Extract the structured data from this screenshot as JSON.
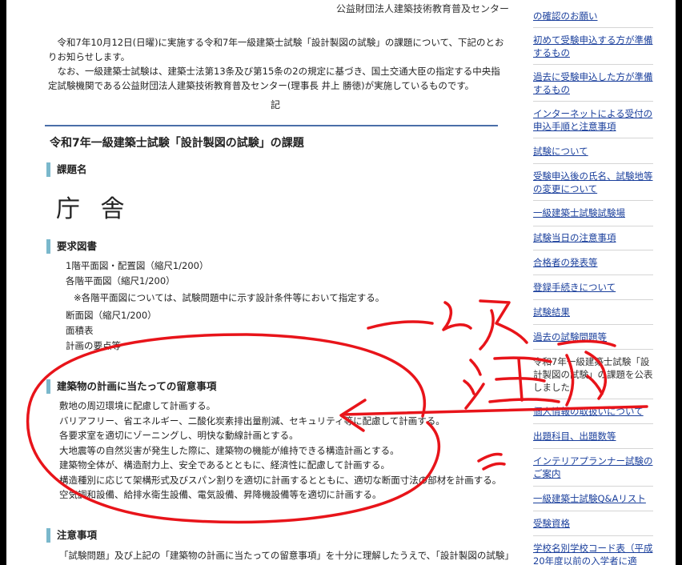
{
  "header": {
    "org": "公益財団法人建築技術教育普及センター"
  },
  "intro": {
    "p1": "令和7年10月12日(日曜)に実施する令和7年一級建築士試験「設計製図の試験」の課題について、下記のとおりお知らせします。",
    "p2": "なお、一級建築士試験は、建築士法第13条及び第15条の2の規定に基づき、国土交通大臣の指定する中央指定試験機関である公益財団法人建築技術教育普及センター(理事長 井上 勝徳)が実施しているものです。",
    "ki": "記"
  },
  "main": {
    "section_title": "令和7年一級建築士試験「設計製図の試験」の課題",
    "h_title": "課題名",
    "title_value": "庁 舎",
    "h_drawings": "要求図書",
    "drawings": [
      "1階平面図・配置図（縮尺1/200）",
      "各階平面図（縮尺1/200）",
      "※各階平面図については、試験問題中に示す設計条件等において指定する。",
      "断面図（縮尺1/200）",
      "面積表",
      "計画の要点等"
    ],
    "h_notes": "建築物の計画に当たっての留意事項",
    "notes": [
      "敷地の周辺環境に配慮して計画する。",
      "バリアフリー、省エネルギー、二酸化炭素排出量削減、セキュリティ等に配慮して計画する。",
      "各要求室を適切にゾーニングし、明快な動線計画とする。",
      "大地震等の自然災害が発生した際に、建築物の機能が維持できる構造計画とする。",
      "建築物全体が、構造耐力上、安全であるとともに、経済性に配慮して計画する。",
      "構造種別に応じて架構形式及びスパン割りを適切に計画するとともに、適切な断面寸法の部材を計画する。",
      "空気調和設備、給排水衛生設備、電気設備、昇降機設備等を適切に計画する。"
    ],
    "h_caution": "注意事項",
    "caution_line": "「試験問題」及び上記の「建築物の計画に当たっての留意事項」を十分に理解したうえで、「設計製図の試験」"
  },
  "sidebar": {
    "items": [
      "の確認のお願い",
      "初めて受験申込する方が準備するもの",
      "過去に受験申込した方が準備するもの",
      "インターネットによる受付の申込手順と注意事項",
      "試験について",
      "受験申込後の氏名、試験地等の変更について",
      "一級建築士試験試験場",
      "試験当日の注意事項",
      "合格者の発表等",
      "登録手続きについて",
      "試験結果",
      "過去の試験問題等",
      "令和7年一級建築士試験「設計製図の試験」の課題を公表しました",
      "個人情報の取扱いについて",
      "出題科目、出題数等",
      "インテリアプランナー試験のご案内",
      "一級建築士試験Q&Aリスト",
      "受験資格",
      "学校名別学校コード表（平成20年度以前の入学者に適"
    ]
  },
  "colors": {
    "link": "#1a3f9c",
    "heading_bar": "#7ab8cc",
    "rule": "#4a6ea8",
    "ink": "#e8141a"
  }
}
